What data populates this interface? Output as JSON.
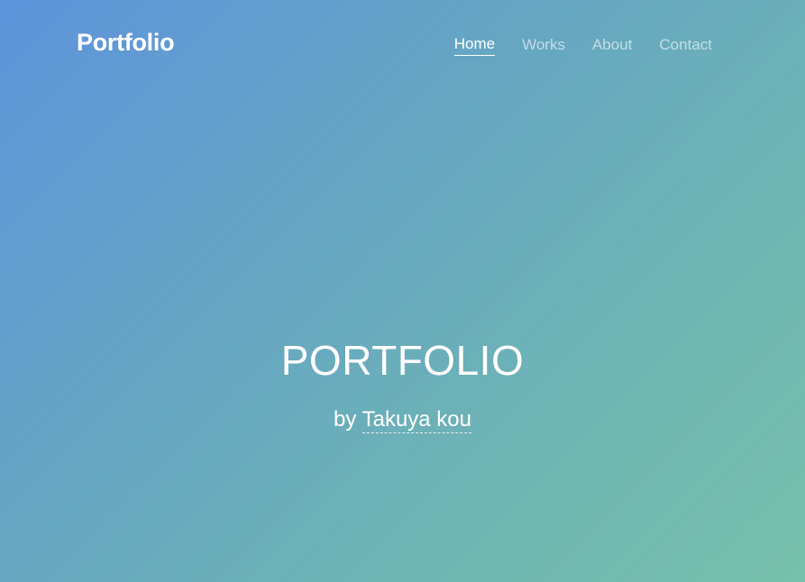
{
  "header": {
    "logo": "Portfolio",
    "nav": [
      {
        "label": "Home",
        "active": true
      },
      {
        "label": "Works",
        "active": false
      },
      {
        "label": "About",
        "active": false
      },
      {
        "label": "Contact",
        "active": false
      }
    ]
  },
  "hero": {
    "title": "PORTFOLIO",
    "by_prefix": "by",
    "author": "Takuya kou"
  },
  "colors": {
    "gradient_start": "#5e94dc",
    "gradient_end": "#77c0aa",
    "text": "#ffffff"
  }
}
